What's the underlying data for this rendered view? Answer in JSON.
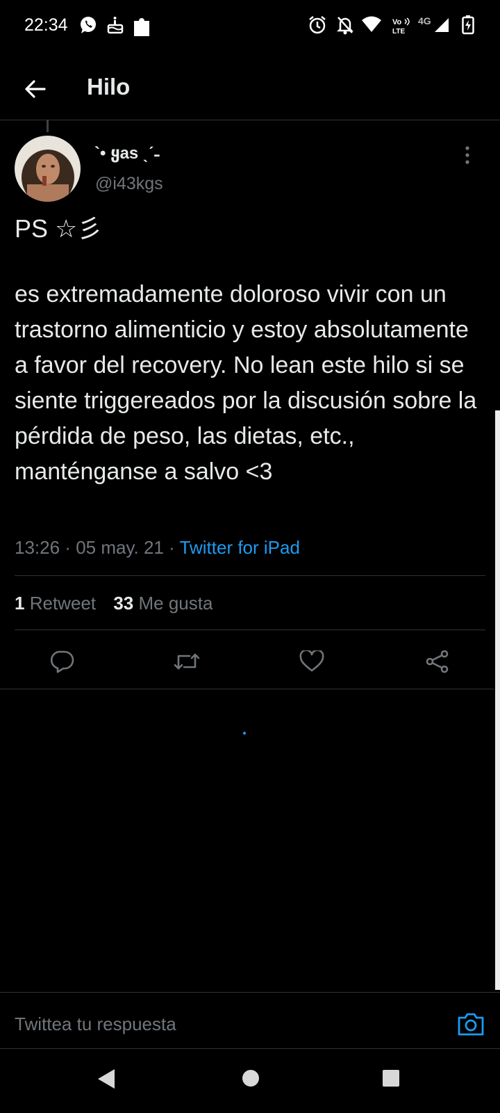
{
  "status_bar": {
    "time": "22:34",
    "network": "4G",
    "left_icons": [
      "whatsapp-icon",
      "cake-icon",
      "puzzle-icon"
    ],
    "right_icons": [
      "alarm-icon",
      "notifications-off-icon",
      "wifi-icon",
      "volte-icon",
      "signal-icon",
      "battery-charging-icon"
    ]
  },
  "app_bar": {
    "title": "Hilo"
  },
  "tweet": {
    "display_name": "`• ყas ˎˊ˗",
    "handle": "@i43kgs",
    "title_line": "PS ☆彡",
    "body": "es extremadamente doloroso vivir con un trastorno alimenticio y estoy absolutamente a favor del recovery. No lean este hilo si se siente triggereados por la discusión sobre la pérdida de peso, las dietas, etc., manténganse a salvo <3",
    "time": "13:26",
    "date": "05 may. 21",
    "source": "Twitter for iPad"
  },
  "stats": {
    "retweets_count": "1",
    "retweets_label": "Retweet",
    "likes_count": "33",
    "likes_label": "Me gusta"
  },
  "reply": {
    "placeholder": "Twittea tu respuesta"
  },
  "colors": {
    "accent": "#1d9bf0",
    "background": "#000000",
    "secondary_text": "#71767b",
    "divider": "#2f3336"
  }
}
